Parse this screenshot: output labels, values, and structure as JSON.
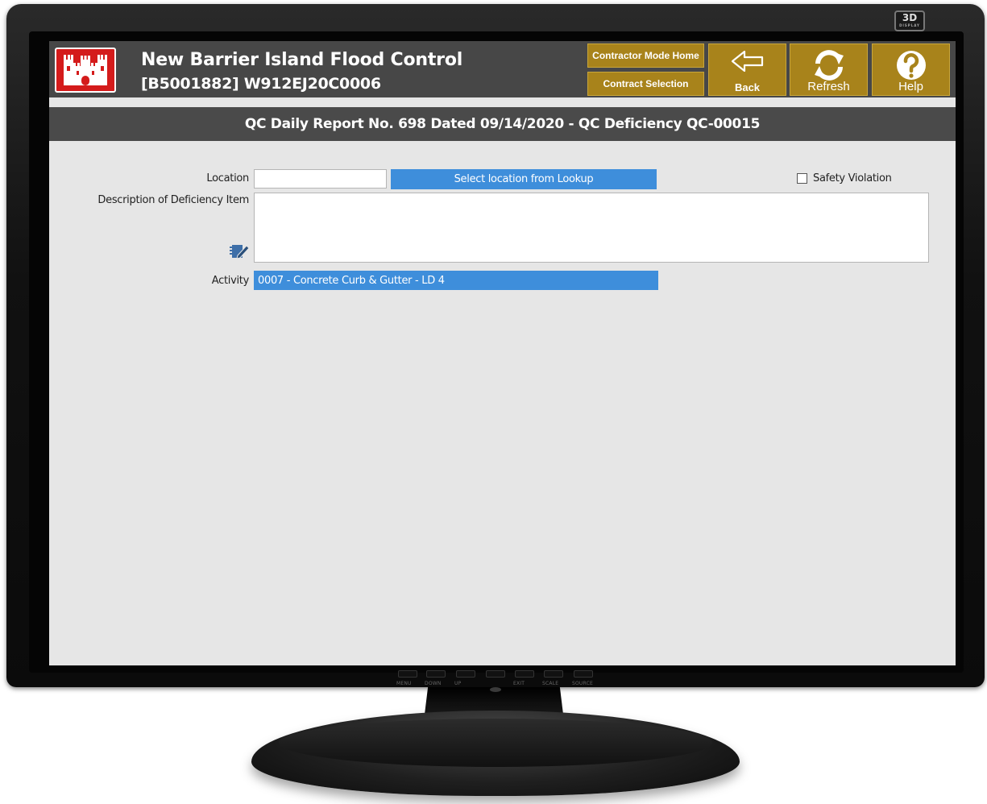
{
  "monitor": {
    "badge": "3D",
    "badge_sub": "DISPLAY",
    "buttons": [
      "MENU",
      "DOWN",
      "UP",
      "EXIT",
      "SCALE",
      "SOURCE"
    ]
  },
  "header": {
    "title": "New Barrier Island Flood Control",
    "subtitle": "[B5001882] W912EJ20C0006",
    "nav": {
      "contractor_home": "Contractor Mode Home",
      "contract_selection": "Contract Selection",
      "back": "Back",
      "refresh": "Refresh",
      "help": "Help"
    }
  },
  "page": {
    "title": "QC Daily Report No. 698 Dated 09/14/2020 - QC Deficiency QC-00015"
  },
  "form": {
    "location_label": "Location",
    "location_value": "",
    "lookup_button": "Select location from Lookup",
    "safety_violation_label": "Safety Violation",
    "safety_violation_checked": false,
    "description_label": "Description of Deficiency Item",
    "description_value": "",
    "activity_label": "Activity",
    "activity_value": "0007 - Concrete Curb & Gutter - LD 4"
  },
  "colors": {
    "accent_gold": "#a8831b",
    "accent_blue": "#3e8edb",
    "header_gray": "#474747",
    "logo_red": "#d41b1b"
  }
}
